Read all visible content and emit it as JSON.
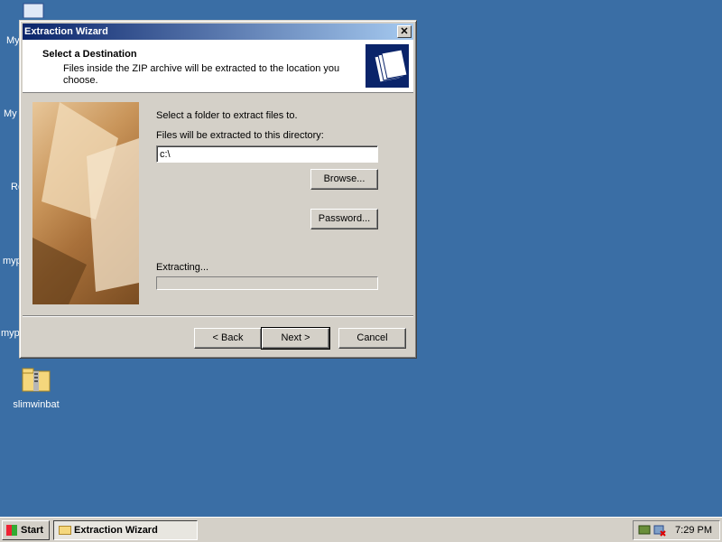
{
  "desktop": {
    "icon_labels": [
      "My",
      "My",
      "Re",
      "myp",
      "myp"
    ],
    "zip_icon_label": "slimwinbat"
  },
  "window": {
    "title": "Extraction Wizard",
    "close_glyph": "✕",
    "header_title": "Select a Destination",
    "header_desc": "Files inside the ZIP archive will be extracted to the location you choose.",
    "header_icon": "folders-icon",
    "instruction": "Select a folder to extract files to.",
    "field_label": "Files will be extracted to this directory:",
    "path_value": "c:\\",
    "browse_label": "Browse...",
    "password_label": "Password...",
    "extracting_label": "Extracting...",
    "progress": 0,
    "back_label": "< Back",
    "next_label": "Next >",
    "cancel_label": "Cancel"
  },
  "taskbar": {
    "start_label": "Start",
    "task_label": "Extraction Wizard",
    "clock": "7:29 PM"
  },
  "colors": {
    "desktop": "#3a6ea5",
    "title_start": "#0a246a",
    "title_end": "#a6caf0",
    "face": "#d4d0c8"
  }
}
